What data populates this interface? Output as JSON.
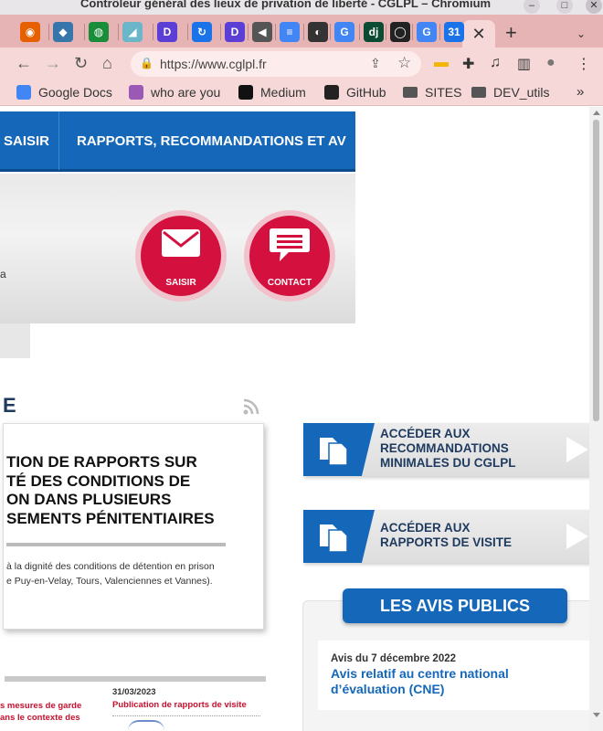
{
  "window": {
    "title": "Contrôleur général des lieux de privation de liberté - CGLPL – Chromium",
    "minimize_glyph": "–",
    "maximize_glyph": "□",
    "close_glyph": "✕"
  },
  "tabs": {
    "items": [
      {
        "icon": "firefox-icon",
        "glyph": "◉",
        "color": "#e66000"
      },
      {
        "icon": "python-icon",
        "glyph": "◆",
        "color": "#3776ab"
      },
      {
        "icon": "green-globe-icon",
        "glyph": "◍",
        "color": "#1a8d3a"
      },
      {
        "icon": "bird-icon",
        "glyph": "◢",
        "color": "#6bb6c8"
      },
      {
        "icon": "d-app-icon",
        "glyph": "D",
        "color": "#5b3ed6"
      },
      {
        "icon": "sync-icon",
        "glyph": "↻",
        "color": "#1a73e8"
      },
      {
        "icon": "d-app-icon-2",
        "glyph": "D",
        "color": "#5b3ed6"
      },
      {
        "icon": "speaker-icon",
        "glyph": "◀",
        "color": "#555555"
      },
      {
        "icon": "google-docs-icon",
        "glyph": "≡",
        "color": "#4285f4"
      },
      {
        "icon": "globe-icon",
        "glyph": "◐",
        "color": "#333333"
      },
      {
        "icon": "google-icon",
        "glyph": "G",
        "color": "#4285f4"
      },
      {
        "icon": "django-icon",
        "glyph": "dj",
        "color": "#0c4b33"
      },
      {
        "icon": "github-icon",
        "glyph": "◯",
        "color": "#222222"
      },
      {
        "icon": "google-icon-2",
        "glyph": "G",
        "color": "#4285f4"
      },
      {
        "icon": "calendar-icon",
        "glyph": "31",
        "color": "#1a73e8"
      }
    ],
    "active_close": "✕",
    "new_tab": "+",
    "menu": "⌄"
  },
  "toolbar": {
    "back": "←",
    "forward": "→",
    "reload": "↻",
    "home": "⌂",
    "lock": "🔒",
    "url": "https://www.cglpl.fr",
    "share": "⇪",
    "bookmark_star": "☆",
    "extensions": [
      {
        "icon": "extension-yellow-icon",
        "glyph": "▬",
        "color": "#f4b400"
      },
      {
        "icon": "puzzle-icon",
        "glyph": "✚",
        "color": "#333333"
      },
      {
        "icon": "media-icon",
        "glyph": "♫",
        "color": "#333333"
      },
      {
        "icon": "sidepanel-icon",
        "glyph": "▥",
        "color": "#333333"
      },
      {
        "icon": "profile-icon",
        "glyph": "●",
        "color": "#777777"
      },
      {
        "icon": "menu-kebab-icon",
        "glyph": "⋮",
        "color": "#333333"
      }
    ]
  },
  "bookmarks": {
    "items": [
      {
        "label": "Google Docs",
        "icon": "google-docs-icon",
        "color": "#4285f4"
      },
      {
        "label": "who are you",
        "icon": "whoareyou-icon",
        "color": "#9b59b6"
      },
      {
        "label": "Medium",
        "icon": "medium-icon",
        "color": "#111111"
      },
      {
        "label": "GitHub",
        "icon": "github-icon",
        "color": "#222222"
      },
      {
        "label": "SITES",
        "icon": "folder-icon",
        "color": "#555555"
      },
      {
        "label": "DEV_utils",
        "icon": "folder-icon",
        "color": "#555555"
      }
    ],
    "more": "»"
  },
  "page": {
    "nav": {
      "item_saisir": "SAISIR",
      "item_rapports": "RAPPORTS, RECOMMANDATIONS ET AV"
    },
    "banner": {
      "saisir_label": "SAISIR",
      "contact_label": "CONTACT",
      "stray_text": "a"
    },
    "section_letter": "E",
    "feature": {
      "headline": "TION DE RAPPORTS SUR\nTÉ DES CONDITIONS DE\nON DANS PLUSIEURS\nSEMENTS PÉNITENTIAIRES",
      "body": "à la dignité des conditions de détention en prison\ne Puy-en-Velay, Tours, Valenciennes et Vannes)."
    },
    "news": {
      "left_text": "s mesures de garde\nans le contexte des",
      "date": "31/03/2023",
      "title": "Publication de rapports de visite"
    },
    "access": [
      {
        "text": "ACCÉDER AUX\nRECOMMANDATIONS\nMINIMALES DU CGLPL"
      },
      {
        "text": "ACCÉDER AUX\nRAPPORTS DE VISITE"
      }
    ],
    "avis": {
      "header": "LES AVIS PUBLICS",
      "date": "Avis du 7 décembre 2022",
      "title": "Avis relatif au centre national\nd’évaluation (CNE)"
    }
  },
  "colors": {
    "brand_blue": "#1567b9",
    "brand_red": "#d4103f",
    "link_red": "#c8102e",
    "tab_strip": "#e6b4b4",
    "toolbar": "#f6d8d8"
  }
}
